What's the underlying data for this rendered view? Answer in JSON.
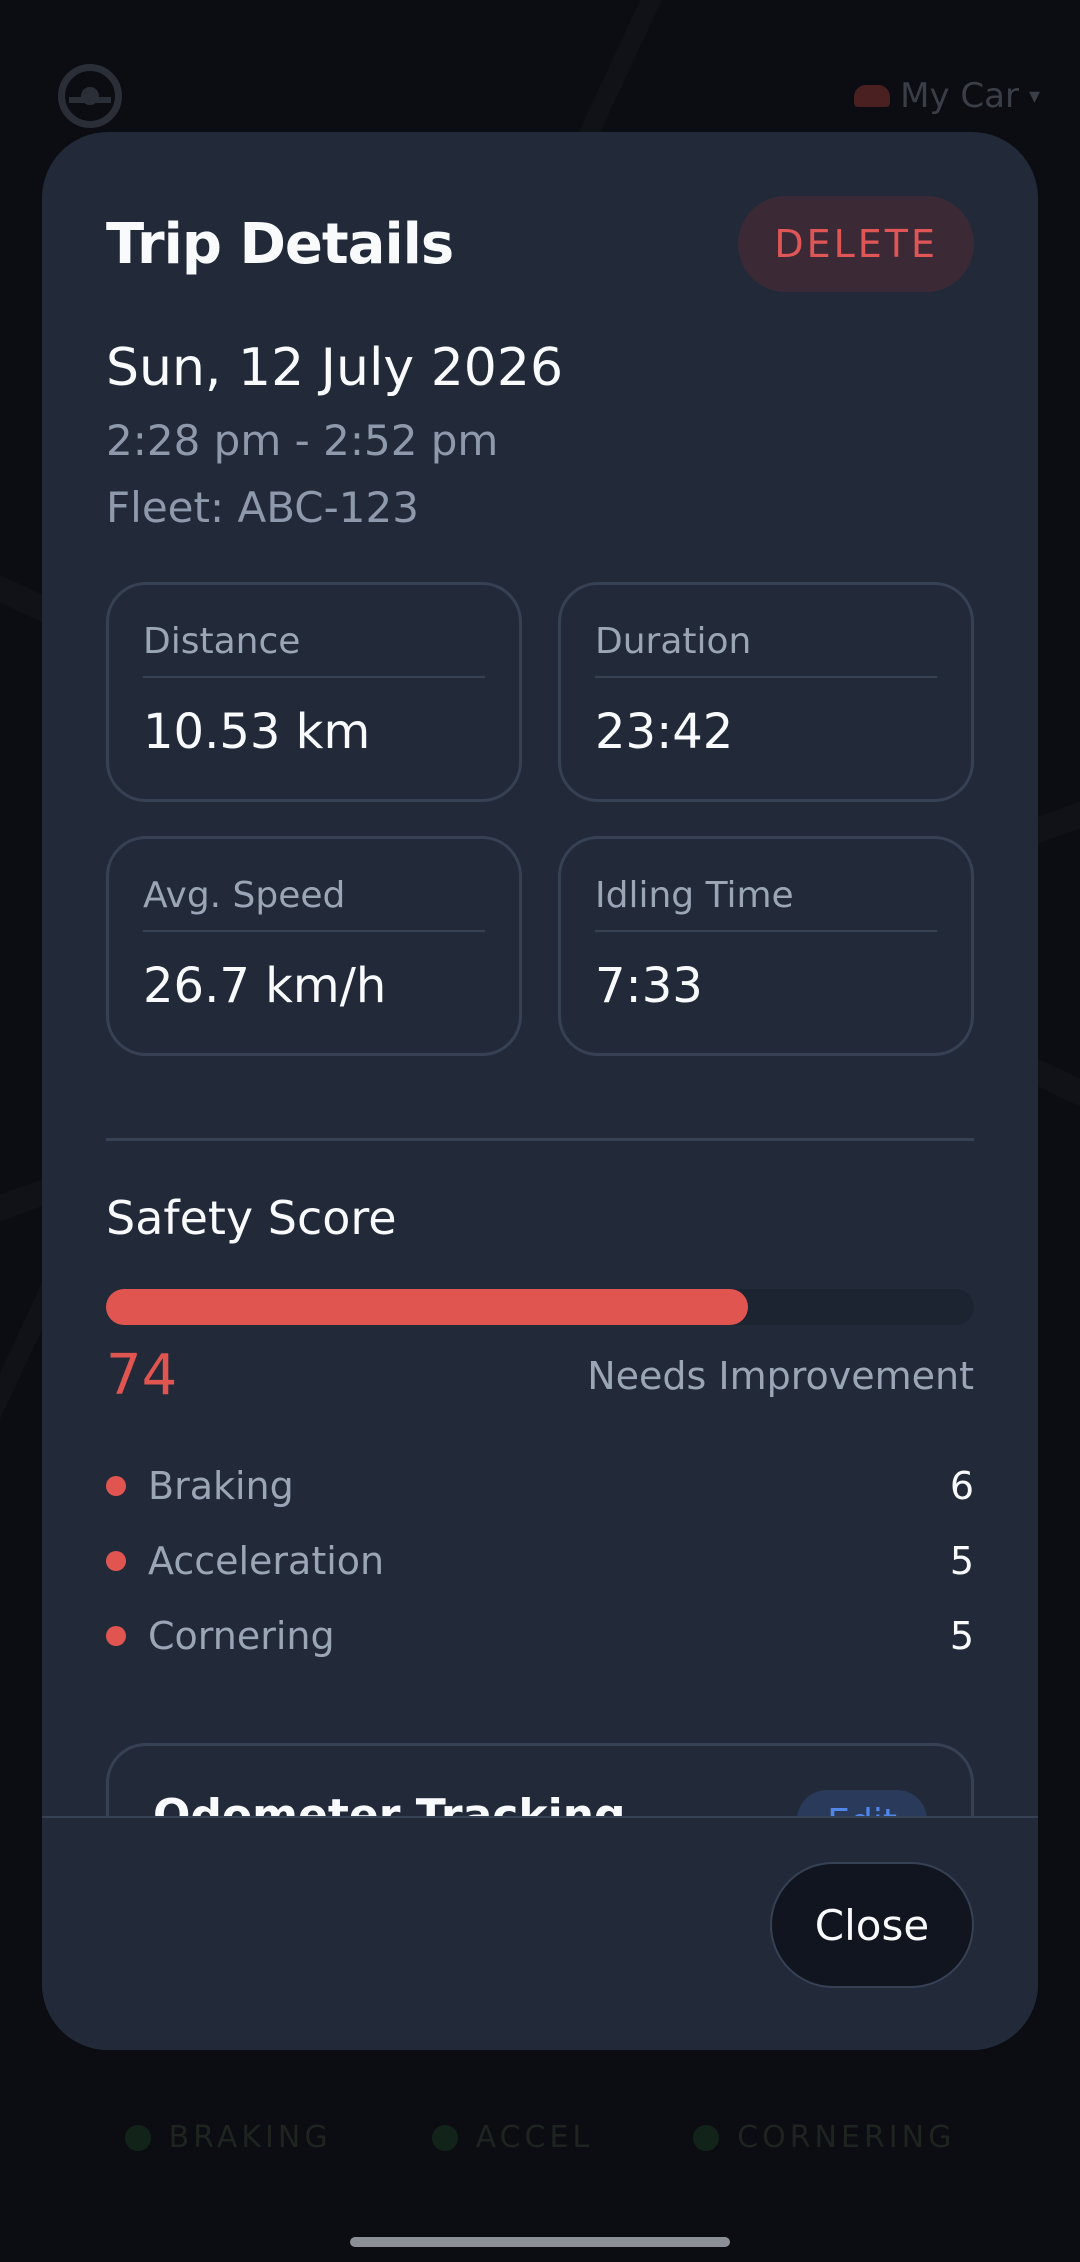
{
  "background": {
    "car_selector": "My Car",
    "legend": [
      "BRAKING",
      "ACCEL",
      "CORNERING"
    ]
  },
  "modal": {
    "title": "Trip Details",
    "delete_label": "DELETE",
    "date": "Sun, 12 July 2026",
    "time_range": "2:28 pm - 2:52 pm",
    "fleet": "Fleet: ABC-123",
    "stats": [
      {
        "label": "Distance",
        "value": "10.53 km"
      },
      {
        "label": "Duration",
        "value": "23:42"
      },
      {
        "label": "Avg. Speed",
        "value": "26.7 km/h"
      },
      {
        "label": "Idling Time",
        "value": "7:33"
      }
    ],
    "safety": {
      "title": "Safety Score",
      "score": "74",
      "score_fraction": 0.74,
      "status": "Needs Improvement",
      "events": [
        {
          "label": "Braking",
          "count": "6"
        },
        {
          "label": "Acceleration",
          "count": "5"
        },
        {
          "label": "Cornering",
          "count": "5"
        }
      ]
    },
    "odometer": {
      "title": "Odometer Tracking",
      "edit_label": "Edit"
    },
    "close_label": "Close"
  },
  "colors": {
    "accent_red": "#e05550",
    "modal_bg": "#222a3a",
    "edit_blue": "#4f86e8"
  }
}
